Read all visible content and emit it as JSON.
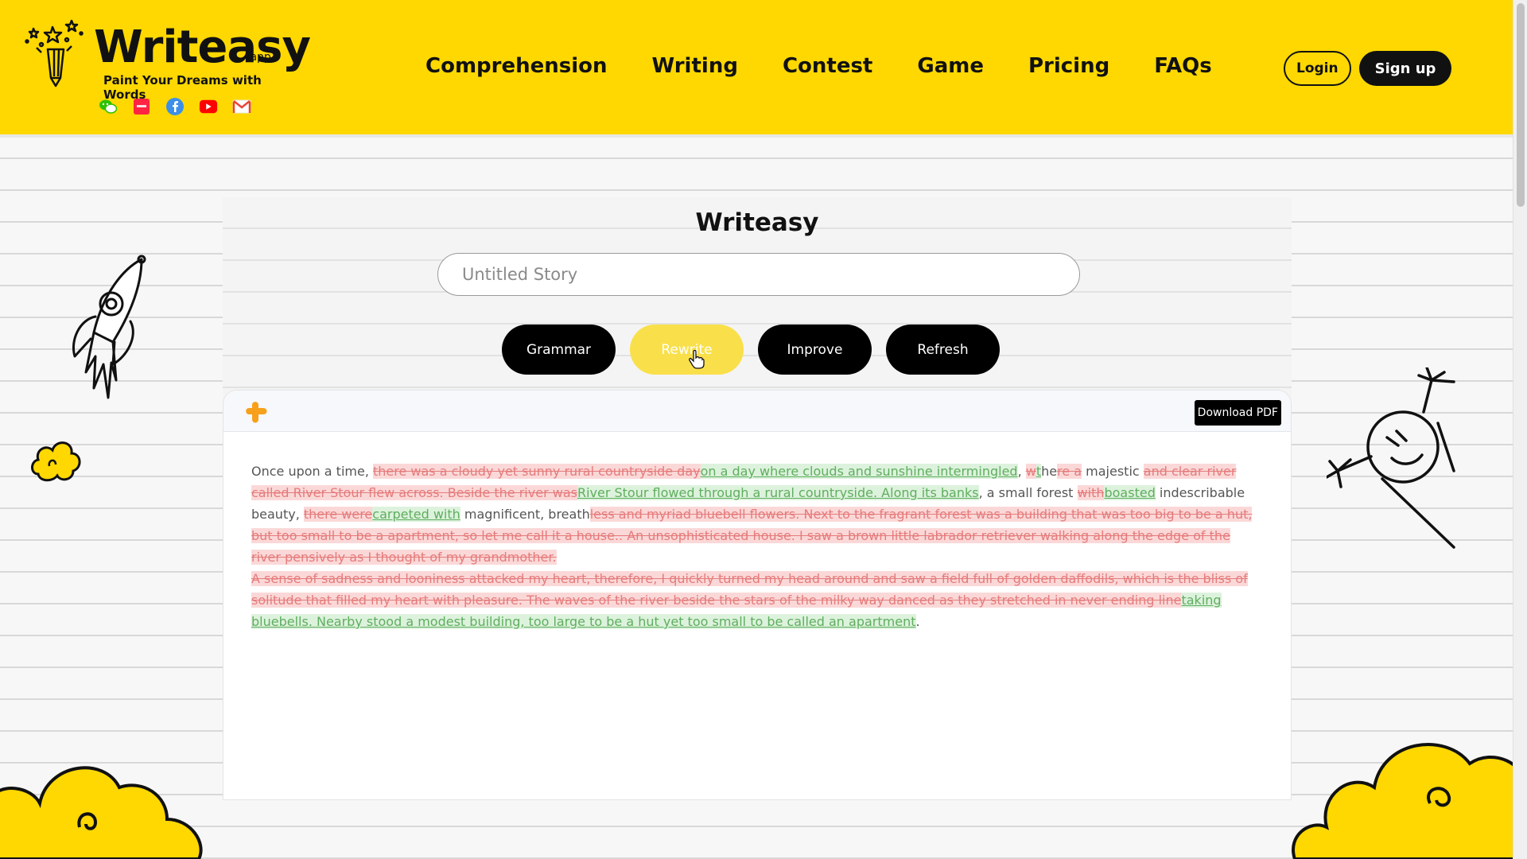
{
  "header": {
    "brand": "Writeasy",
    "brand_suffix": ".app",
    "tagline": "Paint Your Dreams with Words",
    "socials": [
      "wechat-icon",
      "xiaohongshu-icon",
      "facebook-icon",
      "youtube-icon",
      "gmail-icon"
    ],
    "nav": [
      "Comprehension",
      "Writing",
      "Contest",
      "Game",
      "Pricing",
      "FAQs"
    ],
    "login_label": "Login",
    "signup_label": "Sign up"
  },
  "main": {
    "title": "Writeasy",
    "story_placeholder": "Untitled Story",
    "actions": [
      "Grammar",
      "Rewrite",
      "Improve",
      "Refresh"
    ],
    "active_action": "Rewrite",
    "download_label": "Download PDF"
  },
  "editor": {
    "segments": [
      {
        "t": "Once upon a time, ",
        "k": "n"
      },
      {
        "t": "there was a cloudy yet sunny rural countryside day",
        "k": "d"
      },
      {
        "t": "on a day where clouds and sunshine intermingled",
        "k": "i"
      },
      {
        "t": ", ",
        "k": "n"
      },
      {
        "t": "w",
        "k": "d"
      },
      {
        "t": "t",
        "k": "i"
      },
      {
        "t": "he",
        "k": "n"
      },
      {
        "t": "re a",
        "k": "d"
      },
      {
        "t": " majestic ",
        "k": "n"
      },
      {
        "t": "and clear river called River Stour flew across. Beside the river was",
        "k": "d"
      },
      {
        "t": "River Stour flowed through a rural countryside. Along its banks",
        "k": "i"
      },
      {
        "t": ", a small forest ",
        "k": "n"
      },
      {
        "t": "with",
        "k": "d"
      },
      {
        "t": "boasted",
        "k": "i"
      },
      {
        "t": " indescribable beauty, ",
        "k": "n"
      },
      {
        "t": "there were",
        "k": "d"
      },
      {
        "t": "carpeted with",
        "k": "i"
      },
      {
        "t": " magnificent, breath",
        "k": "n"
      },
      {
        "t": "less and myriad bluebell flowers. Next to the fragrant forest was a building that was too big to be a hut, but too small to be a apartment, so let me call it a house.. An unsophisticated house. I saw a brown little labrador retriever walking along the edge of the river pensively as I thought of my grandmother.",
        "k": "d"
      },
      {
        "t": "\n",
        "k": "br"
      },
      {
        "t": "A sense of sadness and looniness attacked my heart, therefore, I quickly turned my head around and saw a field full of golden daffodils, which is the bliss of solitude that filled my heart with pleasure. The waves of the river beside the stars of the milky way danced as they stretched in never ending line",
        "k": "d"
      },
      {
        "t": "taking bluebells. Nearby stood a modest building, too large to be a hut yet too small to be called an apartment",
        "k": "i"
      },
      {
        "t": ".",
        "k": "n"
      }
    ]
  },
  "colors": {
    "header_bg": "#fed800",
    "deleted_bg": "#fbd8d8",
    "deleted_text": "#e57b7b",
    "inserted_bg": "#ddf2dd",
    "inserted_text": "#5fae5f"
  }
}
